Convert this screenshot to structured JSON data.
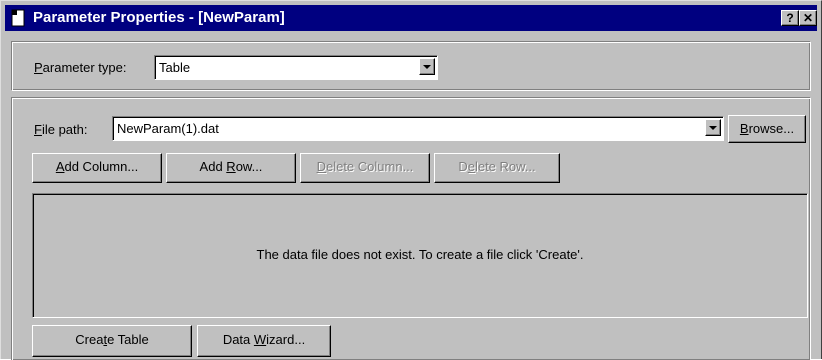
{
  "window": {
    "title": "Parameter Properties - [NewParam]",
    "help_button": "?",
    "close_button": "✕"
  },
  "parameter_type": {
    "label_prefix": "",
    "label_mnemonic": "P",
    "label_rest": "arameter type:",
    "selected_value": "Table"
  },
  "file_path": {
    "label_mnemonic": "F",
    "label_rest": "ile path:",
    "value": "NewParam(1).dat",
    "browse_mnemonic": "B",
    "browse_rest": "rowse..."
  },
  "table_buttons": {
    "add_column": {
      "mn": "A",
      "rest": "dd Column..."
    },
    "add_row": {
      "pre": "Add ",
      "mn": "R",
      "rest": "ow..."
    },
    "delete_column": {
      "mn": "D",
      "rest": "elete Column..."
    },
    "delete_row": {
      "pre": "D",
      "mn": "e",
      "rest": "lete Row..."
    }
  },
  "data_panel": {
    "message": "The data file does not exist. To create a file click 'Create'."
  },
  "bottom_buttons": {
    "create_table": {
      "pre": "Crea",
      "mn": "t",
      "rest": "e Table"
    },
    "data_wizard": {
      "pre": "Data ",
      "mn": "W",
      "rest": "izard..."
    }
  },
  "colors": {
    "titlebar": "#000080",
    "face": "#c0c0c0"
  }
}
